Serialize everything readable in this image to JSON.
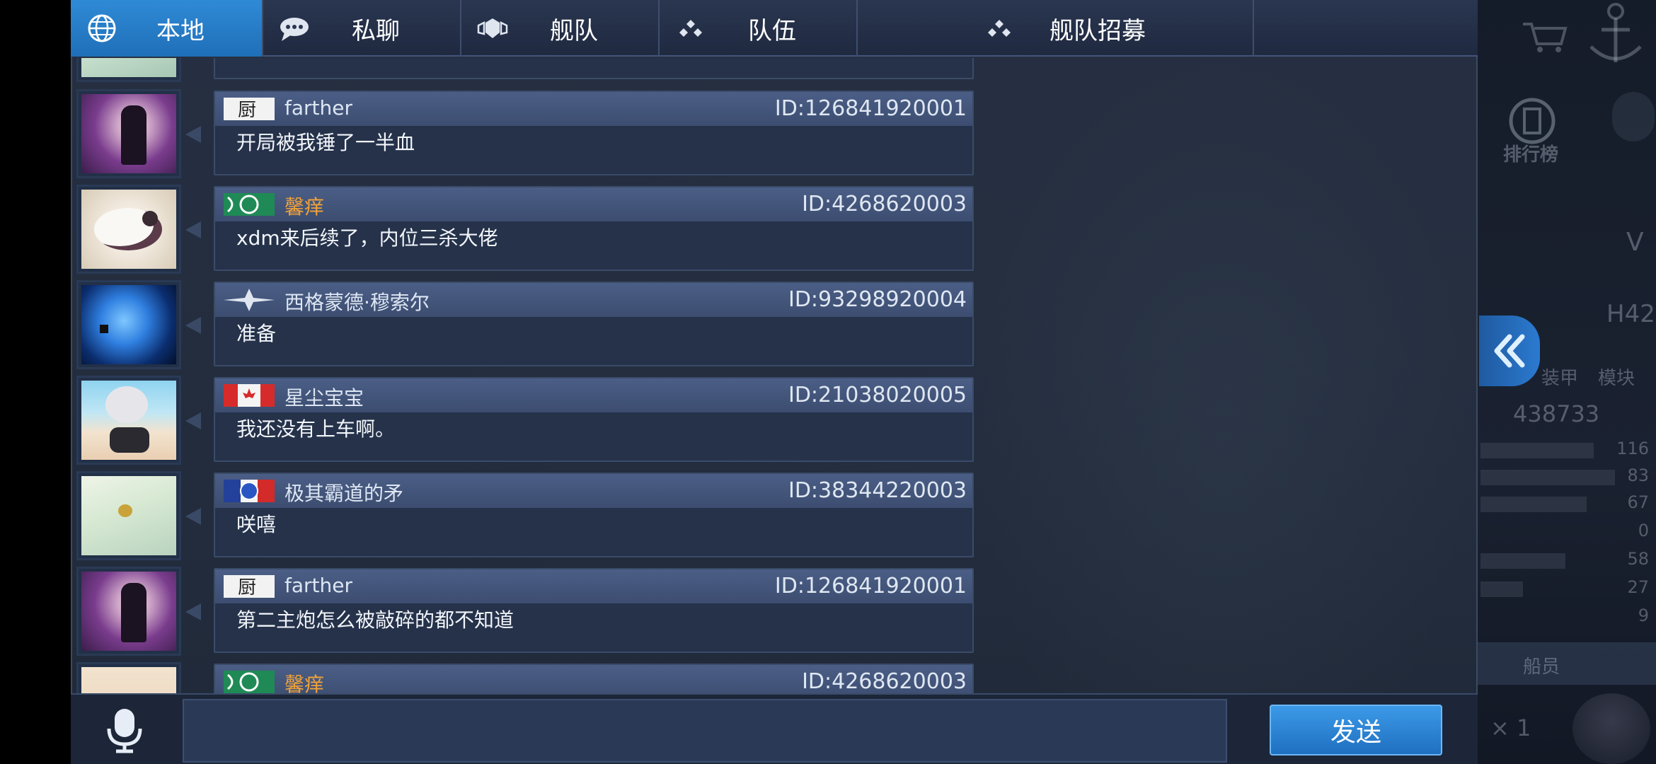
{
  "tabs": [
    {
      "label": "本地",
      "icon": "globe-icon",
      "active": true
    },
    {
      "label": "私聊",
      "icon": "chat-bubble-icon",
      "active": false
    },
    {
      "label": "舰队",
      "icon": "fleet-emblem-icon",
      "active": false
    },
    {
      "label": "队伍",
      "icon": "team-dots-icon",
      "active": false
    },
    {
      "label": "舰队招募",
      "icon": "team-dots-icon",
      "active": false
    }
  ],
  "messages": [
    {
      "name": "farther",
      "id": "ID:126841920001",
      "text": "开局被我锤了一半血",
      "name_color": "#dde6f3",
      "flag": "kitchen-flag-icon",
      "avatar": "purple-flower-girl"
    },
    {
      "name": "馨痒",
      "id": "ID:4268620003",
      "text": "xdm来后续了，内位三杀大佬",
      "name_color": "#f0a23a",
      "flag": "green-emblem-flag-icon",
      "avatar": "cat-plush"
    },
    {
      "name": "西格蒙德·穆索尔",
      "id": "ID:93298920004",
      "text": "准备",
      "name_color": "#dde6f3",
      "flag": "star-flag-icon",
      "avatar": "blue-moon"
    },
    {
      "name": "星尘宝宝",
      "id": "ID:21038020005",
      "text": "我还没有上车啊。",
      "name_color": "#dde6f3",
      "flag": "canada-flag-icon",
      "avatar": "beach-girl"
    },
    {
      "name": "极其霸道的矛",
      "id": "ID:38344220003",
      "text": "咲嘻",
      "name_color": "#dde6f3",
      "flag": "french-emblem-flag-icon",
      "avatar": "green-hair-girl"
    },
    {
      "name": "farther",
      "id": "ID:126841920001",
      "text": "第二主炮怎么被敲碎的都不知道",
      "name_color": "#dde6f3",
      "flag": "kitchen-flag-icon",
      "avatar": "purple-flower-girl"
    },
    {
      "name": "馨痒",
      "id": "ID:4268620003",
      "text": "",
      "name_color": "#f0a23a",
      "flag": "green-emblem-flag-icon",
      "avatar": "beach-partial"
    }
  ],
  "input": {
    "placeholder": ""
  },
  "send_label": "发送",
  "right_panel": {
    "rank_label": "排行榜",
    "letter": "V",
    "ship_code": "H42",
    "armor_label": "装甲",
    "module_label": "模块",
    "power": "438733",
    "stats": [
      "116",
      "83",
      "67",
      "0",
      "58",
      "27",
      "9"
    ],
    "crew_label": "船员",
    "multiplier": "× 1"
  }
}
